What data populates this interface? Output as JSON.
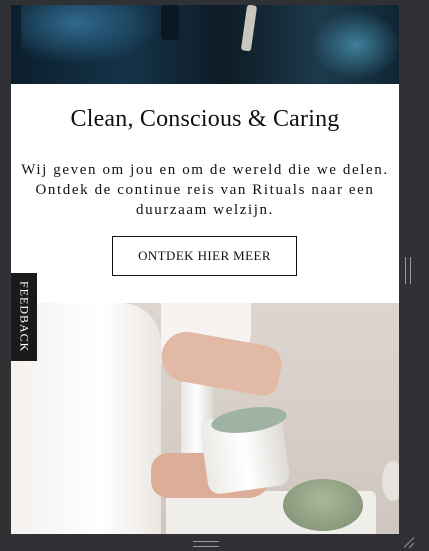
{
  "banner": {
    "title": "Clean, Conscious & Caring",
    "body_line1": "Wij geven om jou en om de wereld die we delen.",
    "body_line2": "Ontdek de continue reis van Rituals naar een",
    "body_line3": "duurzaam welzijn.",
    "cta_label": "ONTDEK HIER MEER"
  },
  "feedback": {
    "label": "FEEDBACK"
  },
  "colors": {
    "background": "#ffffff",
    "text": "#111111",
    "feedback_tab": "#1a1a1a",
    "frame": "#2f3134"
  },
  "images": {
    "top": "dark-blue-product-photo",
    "bottom": "hands-holding-jar-photo"
  }
}
